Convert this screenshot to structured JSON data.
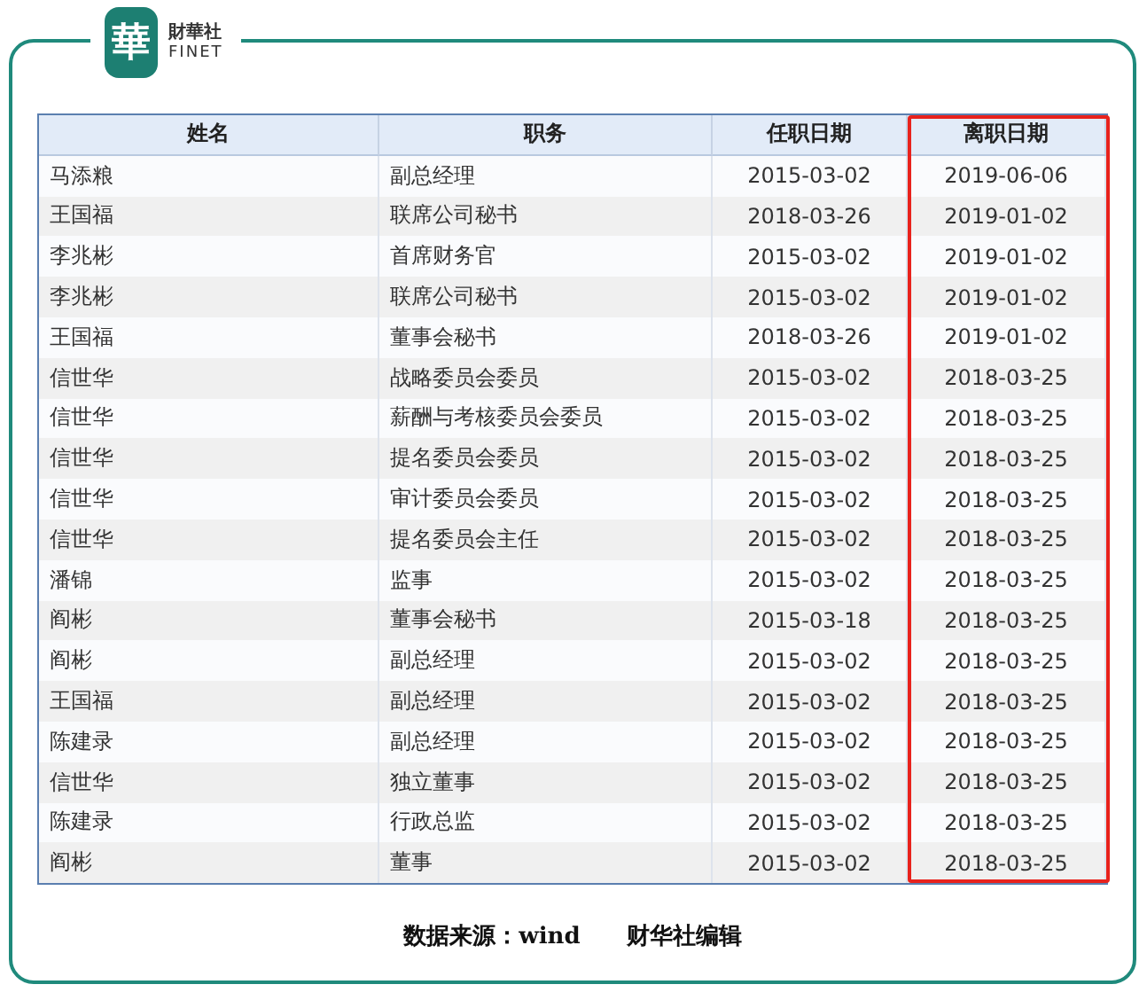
{
  "logo": {
    "mark": "華",
    "name_cn": "財華社",
    "name_en": "FINET"
  },
  "table": {
    "columns": [
      {
        "label": "姓名",
        "highlighted": false
      },
      {
        "label": "职务",
        "highlighted": false
      },
      {
        "label": "任职日期",
        "highlighted": false
      },
      {
        "label": "离职日期",
        "highlighted": true
      }
    ],
    "rows": [
      [
        "马添粮",
        "副总经理",
        "2015-03-02",
        "2019-06-06"
      ],
      [
        "王国福",
        "联席公司秘书",
        "2018-03-26",
        "2019-01-02"
      ],
      [
        "李兆彬",
        "首席财务官",
        "2015-03-02",
        "2019-01-02"
      ],
      [
        "李兆彬",
        "联席公司秘书",
        "2015-03-02",
        "2019-01-02"
      ],
      [
        "王国福",
        "董事会秘书",
        "2018-03-26",
        "2019-01-02"
      ],
      [
        "信世华",
        "战略委员会委员",
        "2015-03-02",
        "2018-03-25"
      ],
      [
        "信世华",
        "薪酬与考核委员会委员",
        "2015-03-02",
        "2018-03-25"
      ],
      [
        "信世华",
        "提名委员会委员",
        "2015-03-02",
        "2018-03-25"
      ],
      [
        "信世华",
        "审计委员会委员",
        "2015-03-02",
        "2018-03-25"
      ],
      [
        "信世华",
        "提名委员会主任",
        "2015-03-02",
        "2018-03-25"
      ],
      [
        "潘锦",
        "监事",
        "2015-03-02",
        "2018-03-25"
      ],
      [
        "阎彬",
        "董事会秘书",
        "2015-03-18",
        "2018-03-25"
      ],
      [
        "阎彬",
        "副总经理",
        "2015-03-02",
        "2018-03-25"
      ],
      [
        "王国福",
        "副总经理",
        "2015-03-02",
        "2018-03-25"
      ],
      [
        "陈建录",
        "副总经理",
        "2015-03-02",
        "2018-03-25"
      ],
      [
        "信世华",
        "独立董事",
        "2015-03-02",
        "2018-03-25"
      ],
      [
        "陈建录",
        "行政总监",
        "2015-03-02",
        "2018-03-25"
      ],
      [
        "阎彬",
        "董事",
        "2015-03-02",
        "2018-03-25"
      ]
    ]
  },
  "caption": "数据来源：wind　　财华社编辑"
}
